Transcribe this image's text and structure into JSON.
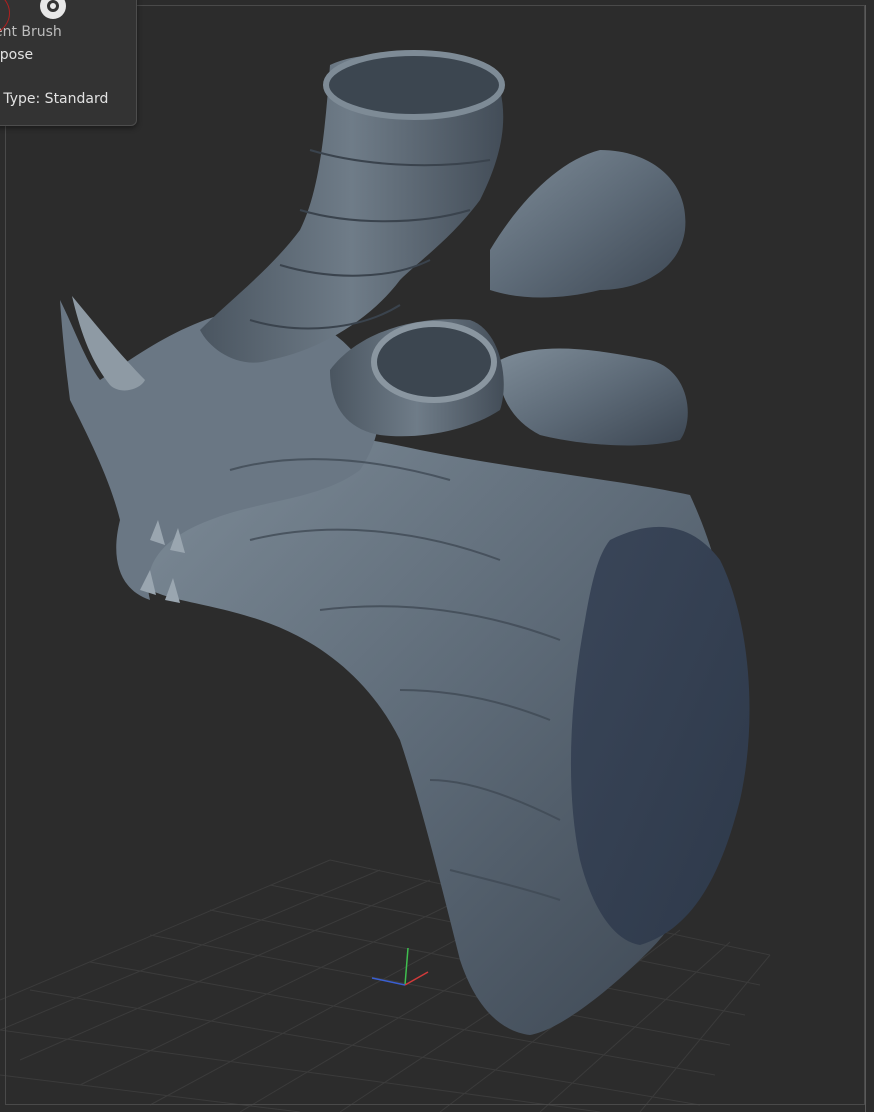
{
  "info_panel": {
    "icon": "brush-target-icon",
    "current_brush_label": "rrent Brush",
    "transpose_label": "anspose",
    "pose_type_label": "se Type: Standard"
  },
  "viewport": {
    "background_color": "#2c2c2c",
    "grid_color": "#3a3a3a",
    "model_color": "#5f6b78",
    "gizmo_colors": {
      "x_axis": "#d23a3a",
      "y_axis": "#3fbf4f",
      "z_axis": "#3a5fd2"
    }
  }
}
